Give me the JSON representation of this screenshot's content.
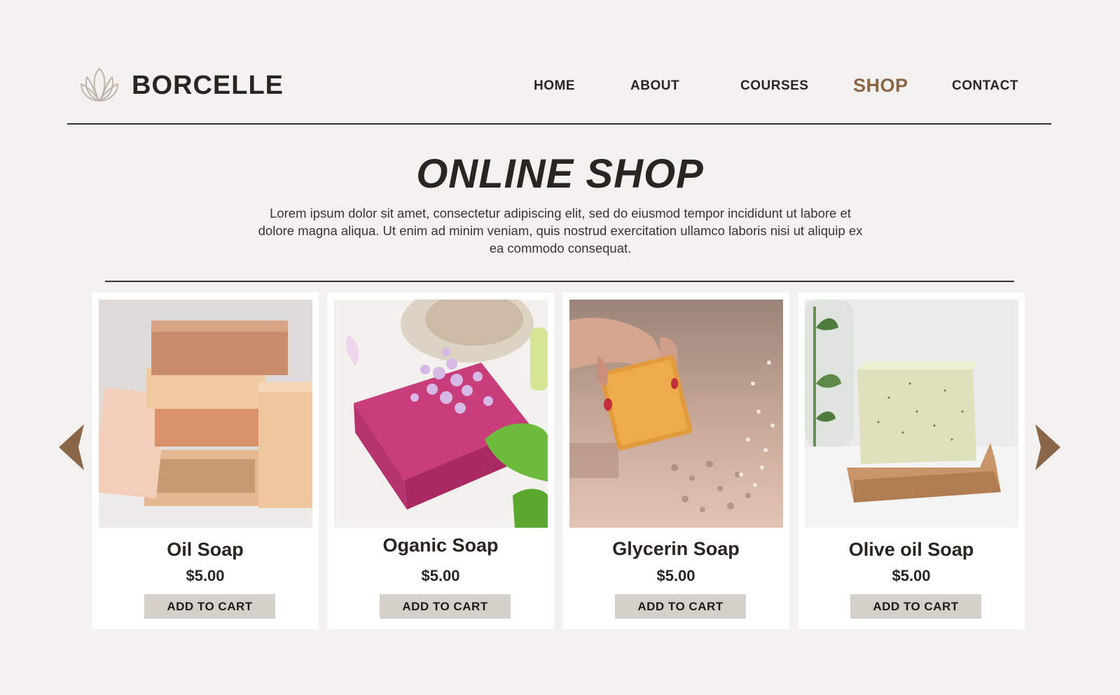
{
  "brand": {
    "name": "BORCELLE",
    "logo_icon": "lotus-icon"
  },
  "nav": {
    "items": [
      {
        "label": "HOME"
      },
      {
        "label": "ABOUT"
      },
      {
        "label": "COURSES"
      },
      {
        "label": "SHOP",
        "active": true
      },
      {
        "label": "CONTACT"
      }
    ]
  },
  "hero": {
    "title": "ONLINE SHOP",
    "description": "Lorem ipsum dolor sit amet, consectetur adipiscing elit, sed do eiusmod tempor incididunt ut labore et dolore magna aliqua. Ut enim ad minim veniam, quis nostrud exercitation ullamco laboris nisi ut aliquip ex ea commodo consequat."
  },
  "products": [
    {
      "name": "Oil Soap",
      "price": "$5.00",
      "button_label": "ADD TO CART"
    },
    {
      "name": "Oganic Soap",
      "price": "$5.00",
      "button_label": "ADD TO CART"
    },
    {
      "name": "Glycerin Soap",
      "price": "$5.00",
      "button_label": "ADD TO CART"
    },
    {
      "name": "Olive oil Soap",
      "price": "$5.00",
      "button_label": "ADD TO CART"
    }
  ],
  "carousel": {
    "prev_icon": "triangle-left-icon",
    "next_icon": "triangle-right-icon"
  },
  "colors": {
    "background": "#f4f2f0",
    "accent": "#8a6648",
    "text": "#2b2522",
    "button": "#d6d0cb",
    "card": "#ffffff"
  }
}
